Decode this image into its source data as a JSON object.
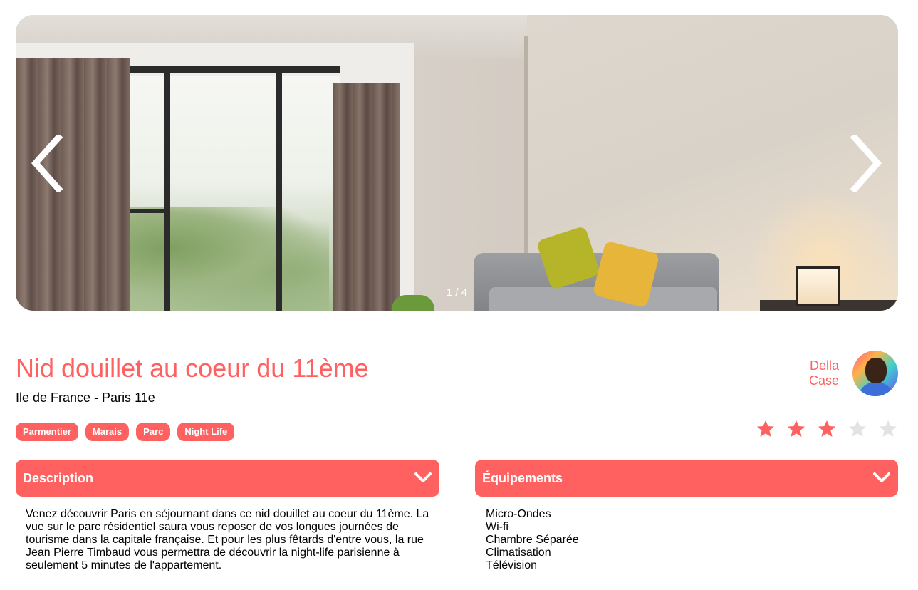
{
  "carousel": {
    "counter": "1 / 4",
    "prev_icon": "chevron-left-icon",
    "next_icon": "chevron-right-icon"
  },
  "listing": {
    "title": "Nid douillet au coeur du 11ème",
    "location": "Ile de France - Paris 11e",
    "tags": [
      "Parmentier",
      "Marais",
      "Parc",
      "Night Life"
    ],
    "rating": 3,
    "rating_max": 5
  },
  "host": {
    "first_name": "Della",
    "last_name": "Case"
  },
  "description": {
    "header": "Description",
    "text": "Venez découvrir Paris en séjournant dans ce nid douillet au coeur du 11ème. La vue sur le parc résidentiel saura vous reposer de vos longues journées de tourisme dans la capitale française. Et pour les plus fêtards d'entre vous, la rue Jean Pierre Timbaud vous permettra de découvrir la night-life parisienne à seulement 5 minutes de l'appartement."
  },
  "equipments": {
    "header": "Équipements",
    "items": [
      "Micro-Ondes",
      "Wi-fi",
      "Chambre Séparée",
      "Climatisation",
      "Télévision"
    ]
  },
  "colors": {
    "accent": "#FF6060",
    "star_active": "#FF6060",
    "star_inactive": "#E3E3E3",
    "text": "#000000",
    "white": "#FFFFFF"
  }
}
